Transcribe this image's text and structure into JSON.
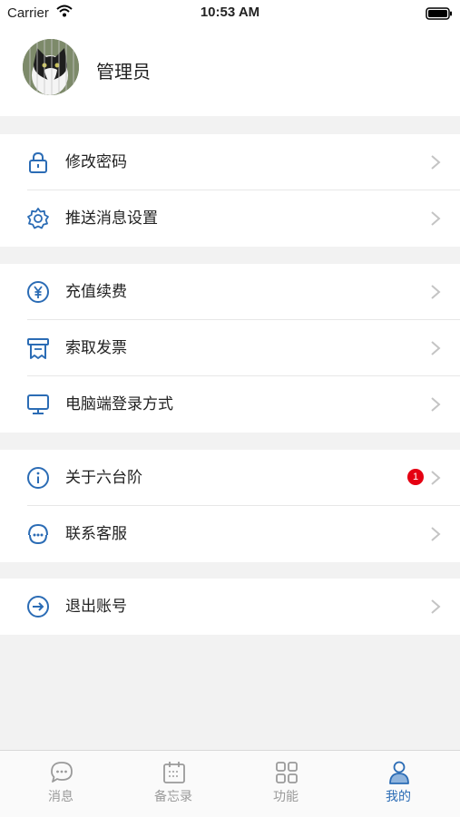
{
  "status_bar": {
    "carrier": "Carrier",
    "time": "10:53 AM"
  },
  "profile": {
    "name": "管理员"
  },
  "menu": {
    "change_password": "修改密码",
    "push_settings": "推送消息设置",
    "recharge": "充值续费",
    "invoice": "索取发票",
    "pc_login": "电脑端登录方式",
    "about": "关于六台阶",
    "about_badge": "1",
    "contact": "联系客服",
    "logout": "退出账号"
  },
  "tabs": [
    {
      "label": "消息"
    },
    {
      "label": "备忘录"
    },
    {
      "label": "功能"
    },
    {
      "label": "我的"
    }
  ],
  "colors": {
    "accent": "#2b6cb5",
    "badge": "#e50012",
    "background": "#f2f2f2"
  }
}
